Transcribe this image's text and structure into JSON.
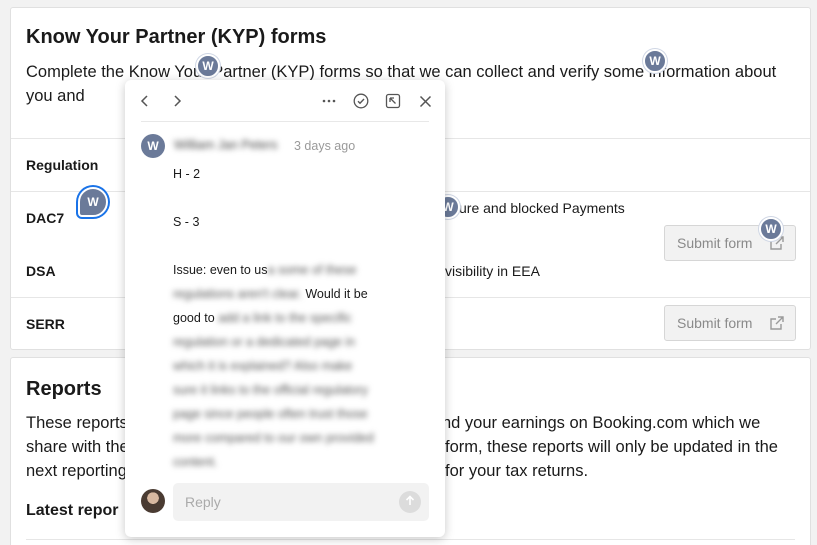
{
  "kyp": {
    "title": "Know Your Partner (KYP) forms",
    "description": "Complete the Know Your Partner (KYP) forms so that we can collect and verify some information about you and",
    "table_header": "Regulation",
    "rows": [
      {
        "label": "DAC7",
        "text": "sure and blocked Payments",
        "button": ""
      },
      {
        "label": "DSA",
        "text": "visibility in EEA",
        "button": "Submit form"
      },
      {
        "label": "SERR",
        "text": "",
        "button": "Submit form"
      }
    ]
  },
  "reports": {
    "title": "Reports",
    "lines": [
      {
        "left": "These reports",
        "right": "nd your earnings on Booking.com which we"
      },
      {
        "left": "share with the",
        "right": "form, these reports will only be updated in the"
      },
      {
        "left": "next reporting",
        "right": "for your tax returns."
      }
    ],
    "latest_label": "Latest repor"
  },
  "pins": {
    "initial": "W"
  },
  "comment": {
    "author_initial": "W",
    "author_name": "William Jan Peters",
    "timestamp": "3 days ago",
    "line_h": "H - 2",
    "line_s": "S - 3",
    "issue_prefix": "Issue: even to us",
    "issue_blur1": "a some of these",
    "issue_blur2": "regulations aren't clear.",
    "issue_visible1": "Would it be",
    "issue_visible2": "good to",
    "issue_blur3": "add a link to the specific",
    "blurred_lines": [
      "regulation or a dedicated page in",
      "which it is explained? Also make",
      "sure it links to the official regulatory",
      "page since people often trust those",
      "more compared to our own provided",
      "content."
    ],
    "reply_placeholder": "Reply"
  },
  "icons": {
    "prev": "chevron-left-icon",
    "next": "chevron-right-icon",
    "more": "more-icon",
    "resolve": "check-circle-icon",
    "expand": "expand-icon",
    "close": "close-icon",
    "external": "external-link-icon",
    "send": "arrow-up-icon"
  },
  "colors": {
    "pin": "#6b7a99",
    "active_ring": "#1a73e8"
  }
}
